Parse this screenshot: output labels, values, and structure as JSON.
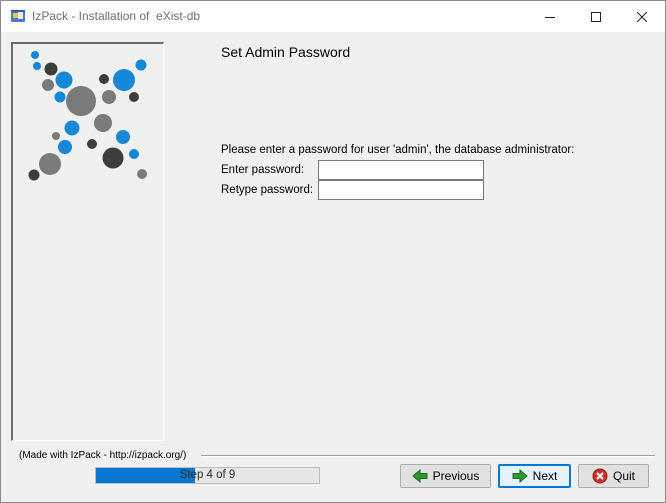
{
  "window": {
    "title": "IzPack - Installation of  eXist-db",
    "controls": {
      "minimize_icon": "minimize-icon",
      "maximize_icon": "maximize-icon",
      "close_icon": "close-icon"
    }
  },
  "panel": {
    "title": "Set Admin Password",
    "prompt": "Please enter a password for user 'admin', the database administrator:",
    "fields": [
      {
        "label": "Enter password:",
        "value": ""
      },
      {
        "label": "Retype password:",
        "value": ""
      }
    ]
  },
  "footer": {
    "made_with": "(Made with IzPack - http://izpack.org/)",
    "progress": {
      "text": "Step 4 of 9",
      "current": 4,
      "total": 9
    }
  },
  "buttons": {
    "previous": "Previous",
    "next": "Next",
    "quit": "Quit"
  },
  "colors": {
    "accent_blue": "#0678d4",
    "logo_blue": "#1688d8",
    "logo_dark": "#3d3d3d",
    "logo_gray": "#7a7a7a",
    "arrow_green": "#2e9a2e",
    "quit_red": "#d0302a"
  }
}
